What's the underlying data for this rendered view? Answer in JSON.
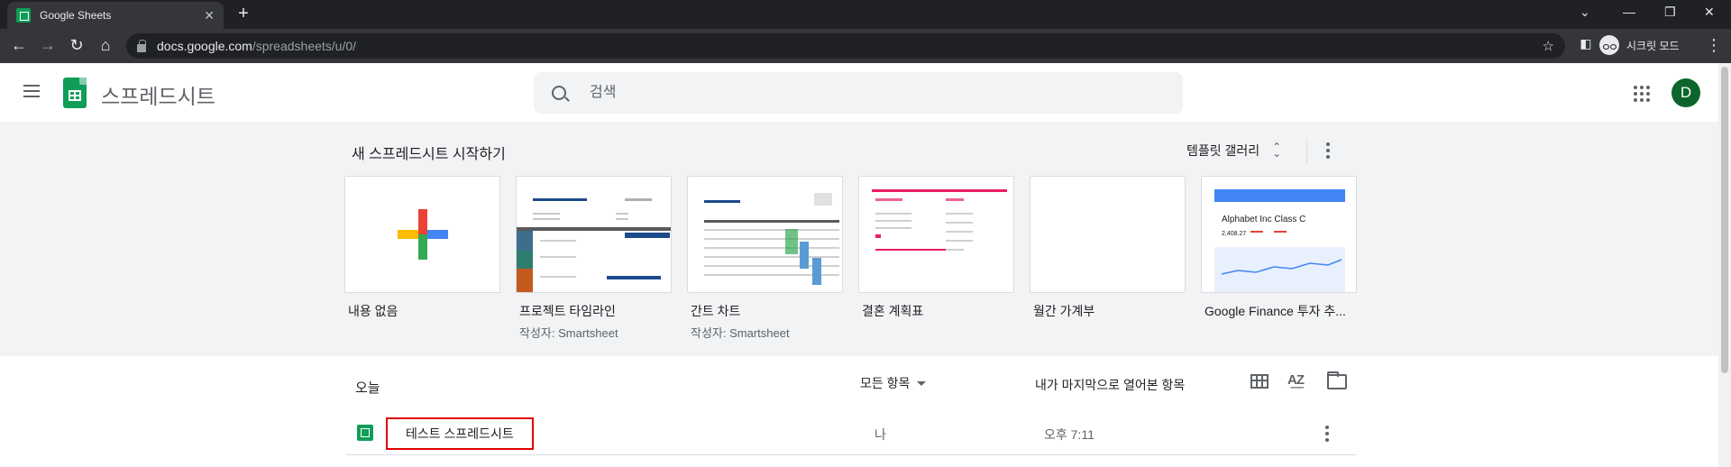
{
  "browser": {
    "tab_title": "Google Sheets",
    "url_host": "docs.google.com",
    "url_path": "/spreadsheets/u/0/",
    "incognito_label": "시크릿 모드"
  },
  "header": {
    "app_title": "스프레드시트",
    "search_placeholder": "검색",
    "avatar_initial": "D"
  },
  "gallery": {
    "title": "새 스프레드시트 시작하기",
    "gallery_link": "템플릿 갤러리",
    "templates": [
      {
        "label": "내용 없음",
        "sub": ""
      },
      {
        "label": "프로젝트 타임라인",
        "sub": "작성자: Smartsheet"
      },
      {
        "label": "간트 차트",
        "sub": "작성자: Smartsheet"
      },
      {
        "label": "결혼 계획표",
        "sub": ""
      },
      {
        "label": "월간 가계부",
        "sub": ""
      },
      {
        "label": "Google Finance 투자 추...",
        "sub": ""
      }
    ],
    "finance_preview": {
      "title": "Alphabet Inc Class C",
      "price": "2,408.27"
    }
  },
  "files": {
    "section_label": "오늘",
    "owner_filter": "모든 항목",
    "sort_label": "내가 마지막으로 열어본 항목",
    "rows": [
      {
        "name": "테스트 스프레드시트",
        "owner": "나",
        "date": "오후 7:11"
      }
    ]
  },
  "colors": {
    "sheets_green": "#0f9d58",
    "highlight_red": "#e00000",
    "gallery_bg": "#f1f3f4"
  }
}
